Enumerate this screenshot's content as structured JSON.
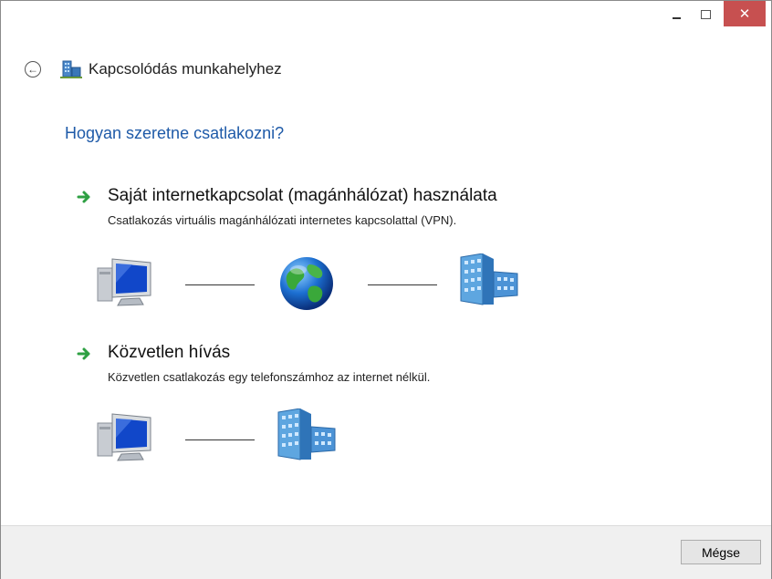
{
  "window": {
    "title": "Kapcsolódás munkahelyhez",
    "close_glyph": "✕"
  },
  "nav": {
    "back_glyph": "←",
    "icon": "workplace-network-icon"
  },
  "page": {
    "question": "Hogyan szeretne csatlakozni?",
    "options": [
      {
        "title": "Saját internetkapcsolat (magánhálózat) használata",
        "description": "Csatlakozás virtuális magánhálózati internetes kapcsolattal (VPN).",
        "diagram": [
          "computer-icon",
          "globe-icon",
          "office-building-icon"
        ]
      },
      {
        "title": "Közvetlen hívás",
        "description": "Közvetlen csatlakozás egy telefonszámhoz az internet nélkül.",
        "diagram": [
          "computer-icon",
          "office-building-icon"
        ]
      }
    ]
  },
  "footer": {
    "cancel_label": "Mégse"
  },
  "colors": {
    "heading": "#1e5aa8",
    "close_button": "#c75050",
    "arrow_green": "#2ea043",
    "footer_bg": "#f0f0f0"
  }
}
